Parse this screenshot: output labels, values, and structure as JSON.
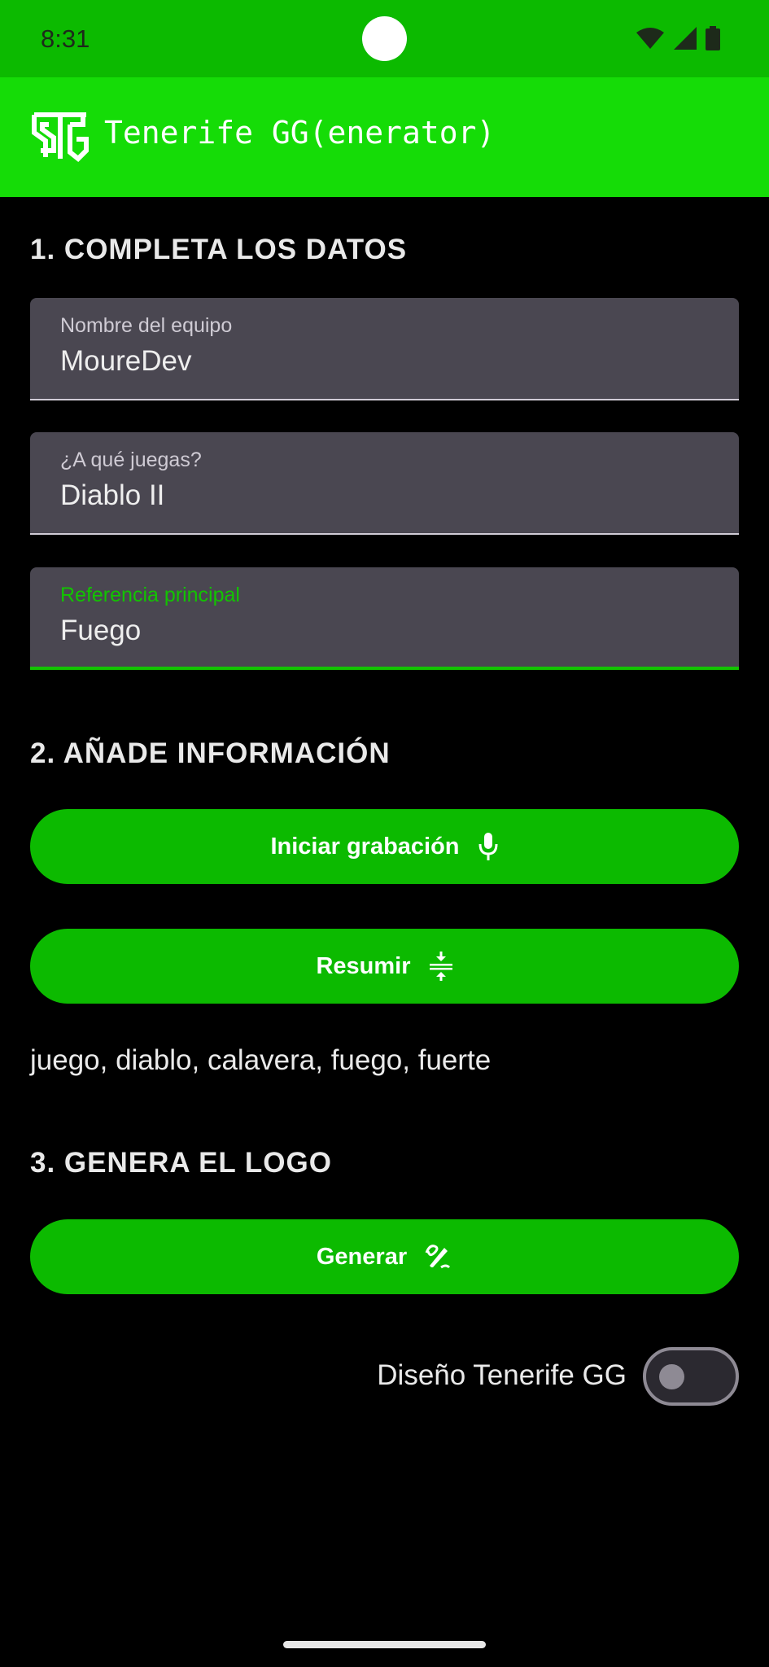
{
  "status_bar": {
    "time": "8:31",
    "icons": [
      "wifi-icon",
      "signal-icon",
      "battery-icon"
    ],
    "color": "#0cba00"
  },
  "app_bar": {
    "logo_icon": "tgg-logo-icon",
    "title": "Tenerife GG(enerator)",
    "color": "#15dc07"
  },
  "section1": {
    "title": "1. COMPLETA LOS DATOS",
    "fields": [
      {
        "label": "Nombre del equipo",
        "value": "MoureDev"
      },
      {
        "label": "¿A qué juegas?",
        "value": "Diablo II"
      },
      {
        "label": "Referencia principal",
        "value": "Fuego"
      }
    ]
  },
  "section2": {
    "title": "2. AÑADE INFORMACIÓN",
    "record_button": {
      "label": "Iniciar grabación",
      "icon": "mic-icon"
    },
    "summarize_button": {
      "label": "Resumir",
      "icon": "compress-icon"
    },
    "keywords": "juego, diablo, calavera, fuego, fuerte"
  },
  "section3": {
    "title": "3. GENERA EL LOGO",
    "generate_button": {
      "label": "Generar",
      "icon": "draw-icon"
    },
    "design_switch": {
      "label": "Diseño Tenerife GG",
      "checked": false
    }
  },
  "colors": {
    "accent": "#0cba00",
    "field_bg": "#4a4751",
    "background": "#000000"
  }
}
